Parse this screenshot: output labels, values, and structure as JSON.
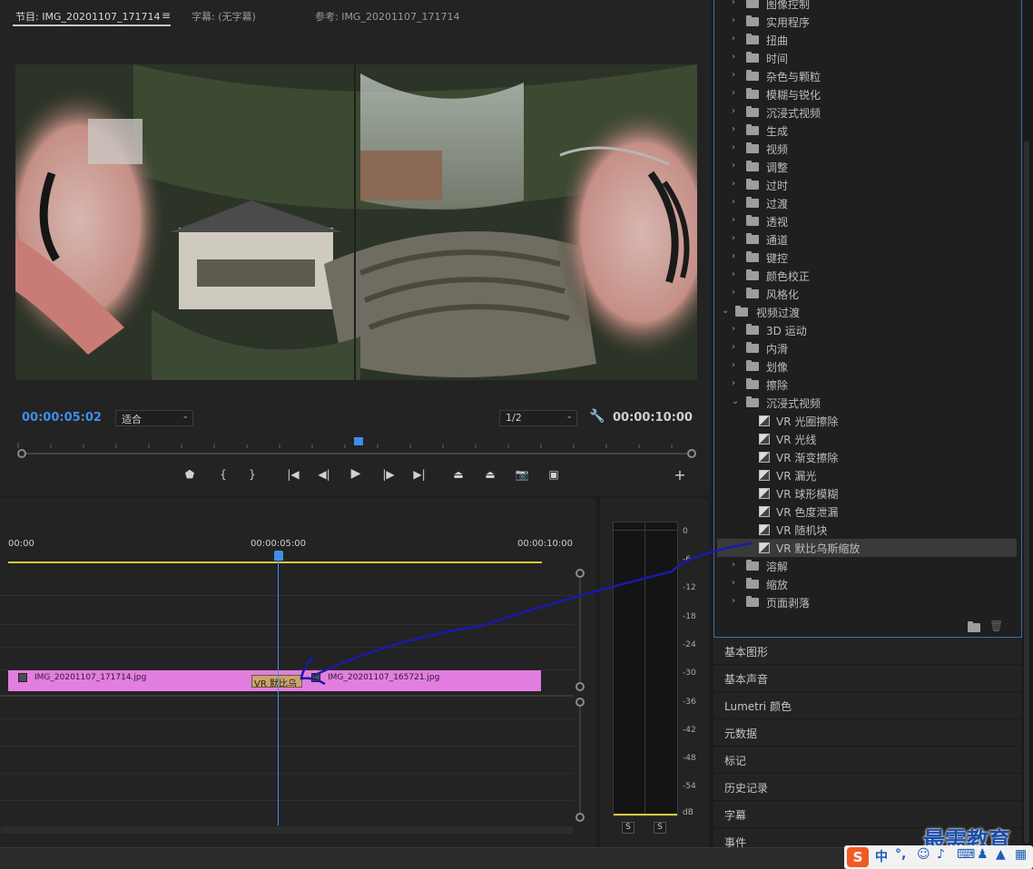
{
  "program_monitor": {
    "tabs": [
      {
        "label": "节目: IMG_20201107_171714"
      },
      {
        "label": "字幕: (无字幕)"
      },
      {
        "label": "参考: IMG_20201107_171714"
      }
    ],
    "menu_icon": "≡",
    "current_timecode": "00:00:05:02",
    "fit_dropdown": "适合",
    "resolution_dropdown": "1/2",
    "duration_timecode": "00:00:10:00",
    "transport_icons": [
      "marker-icon",
      "mark-in-icon",
      "mark-out-icon",
      "go-to-in-icon",
      "step-back-icon",
      "play-icon",
      "step-forward-icon",
      "go-to-out-icon",
      "lift-icon",
      "extract-icon",
      "export-frame-icon",
      "compare-view-icon",
      "add-button-icon"
    ]
  },
  "timeline": {
    "ruler": [
      "00:00",
      "00:00:05:00",
      "00:00:10:00"
    ],
    "clips": [
      {
        "name": "IMG_20201107_171714.jpg"
      },
      {
        "name": "IMG_20201107_165721.jpg"
      }
    ],
    "transition_label": "VR 默比乌"
  },
  "audio_meter": {
    "db_labels": [
      "0",
      "-6",
      "-12",
      "-18",
      "-24",
      "-30",
      "-36",
      "-42",
      "-48",
      "-54",
      "dB"
    ],
    "solo_buttons": [
      "S",
      "S"
    ]
  },
  "effects_tree": {
    "top_partial": "图像控制",
    "video_effects_folders": [
      "实用程序",
      "扭曲",
      "时间",
      "杂色与颗粒",
      "模糊与锐化",
      "沉浸式视频",
      "生成",
      "视频",
      "调整",
      "过时",
      "过渡",
      "透视",
      "通道",
      "键控",
      "颜色校正",
      "风格化"
    ],
    "video_transitions_label": "视频过渡",
    "transition_folders_before": [
      "3D 运动",
      "内滑",
      "划像",
      "擦除"
    ],
    "immersive_folder": "沉浸式视频",
    "vr_transitions": [
      "VR 光圈擦除",
      "VR 光线",
      "VR 渐变擦除",
      "VR 漏光",
      "VR 球形模糊",
      "VR 色度泄漏",
      "VR 随机块",
      "VR 默比乌斯缩放"
    ],
    "transition_folders_after": [
      "溶解",
      "缩放",
      "页面剥落"
    ]
  },
  "side_panels": [
    "基本图形",
    "基本声音",
    "Lumetri 颜色",
    "元数据",
    "标记",
    "历史记录",
    "字幕",
    "事件"
  ],
  "ime_bar": {
    "logo": "S",
    "mode": "中",
    "punct": "°,"
  },
  "watermark": "最需教育",
  "colors": {
    "accent_blue": "#3f8ee8",
    "clip_pink": "#e27ee0",
    "transition_tan": "#c9a46f",
    "arrow_annotation": "#1a1aa8"
  }
}
